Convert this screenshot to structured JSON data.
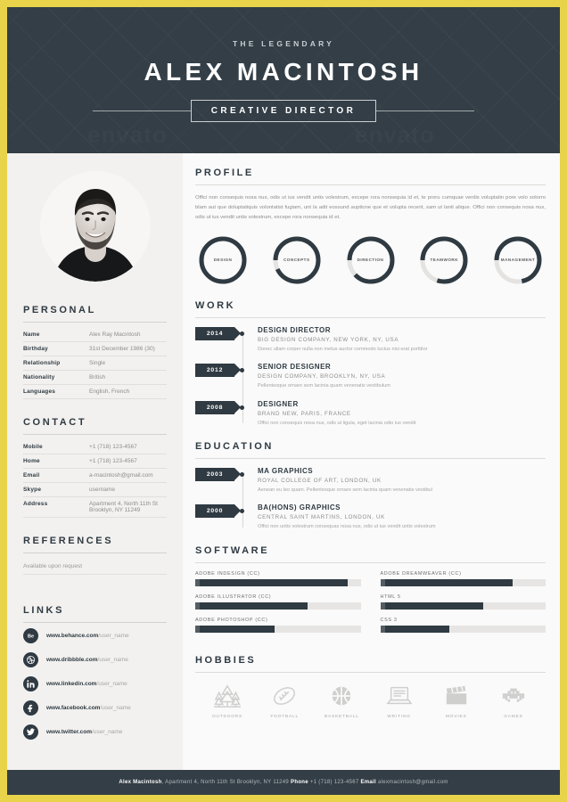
{
  "theme": {
    "border_gold": "#e8d34a",
    "dark": "#2f3a42",
    "header_bg": "#333e46",
    "sidebar_bg": "#f2f1ef",
    "page_bg": "#fafafa"
  },
  "header": {
    "eyebrow": "THE LEGENDARY",
    "name": "ALEX MACINTOSH",
    "role": "CREATIVE DIRECTOR"
  },
  "sidebar": {
    "personal": {
      "title": "PERSONAL",
      "rows": [
        {
          "label": "Name",
          "value": "Alex Ray Macintosh"
        },
        {
          "label": "Birthday",
          "value": "31st December 1986 (30)"
        },
        {
          "label": "Relationship",
          "value": "Single"
        },
        {
          "label": "Nationality",
          "value": "British"
        },
        {
          "label": "Languages",
          "value": "English, French"
        }
      ]
    },
    "contact": {
      "title": "CONTACT",
      "rows": [
        {
          "label": "Mobile",
          "value": "+1 (718) 123-4567"
        },
        {
          "label": "Home",
          "value": "+1 (718) 123-4567"
        },
        {
          "label": "Email",
          "value": "a-macintosh@gmail.com"
        },
        {
          "label": "Skype",
          "value": "username"
        },
        {
          "label": "Address",
          "value": "Apartment 4, North 11th St Brooklyn, NY 11249"
        }
      ]
    },
    "references": {
      "title": "REFERENCES",
      "text": "Available upon request"
    },
    "links": {
      "title": "LINKS",
      "items": [
        {
          "icon": "behance-icon",
          "domain": "www.behance.com",
          "path": "/user_name"
        },
        {
          "icon": "dribbble-icon",
          "domain": "www.dribbble.com",
          "path": "/user_name"
        },
        {
          "icon": "linkedin-icon",
          "domain": "www.linkedin.com",
          "path": "/user_name"
        },
        {
          "icon": "facebook-icon",
          "domain": "www.facebook.com",
          "path": "/user_name"
        },
        {
          "icon": "twitter-icon",
          "domain": "www.twitter.com",
          "path": "/user_name"
        }
      ]
    }
  },
  "main": {
    "profile": {
      "title": "PROFILE",
      "text": "Offici non consequis nosa nus, odis ut ius vendit untis volestrum, excepe rora nonsequia id et, te proru cumquae verdis voluptatin pore volo solorro blam aut que doluptatiquis volontatist fugiam, unt la adit eossund auptione que et volupta recerit, sam ut lanit alique. Offici non consequis nosa nus, odis ut ius vendit untis volestrum, excepe rora nonsequia id et."
    },
    "skills_donuts": [
      {
        "label": "DESIGN",
        "percent": 100
      },
      {
        "label": "CONCEPTS",
        "percent": 93
      },
      {
        "label": "DIRECTION",
        "percent": 88
      },
      {
        "label": "TEAMWORK",
        "percent": 80
      },
      {
        "label": "MANAGEMENT",
        "percent": 72
      }
    ],
    "work": {
      "title": "WORK",
      "items": [
        {
          "year": "2014",
          "role": "DESIGN DIRECTOR",
          "org": "BIG DESIGN COMPANY, NEW YORK, NY, USA",
          "desc": "Donec ullam corper nulla non metus auctor commodo luctus nisi erat porttitor"
        },
        {
          "year": "2012",
          "role": "SENIOR DESIGNER",
          "org": "DESIGN COMPANY, BROOKLYN, NY, USA",
          "desc": "Pellentesque ornare sem lacinia quam venenatis vestibulum"
        },
        {
          "year": "2008",
          "role": "DESIGNER",
          "org": "BRAND NEW, PARIS, FRANCE",
          "desc": "Offici non consequis nosa nus, odis ut ligula, eget lacinia odio ius vendit"
        }
      ]
    },
    "education": {
      "title": "EDUCATION",
      "items": [
        {
          "year": "2003",
          "role": "MA GRAPHICS",
          "org": "ROYAL COLLEGE OF ART, LONDON, UK",
          "desc": "Aenean eu leo quam. Pellentesque ornare sem lacinia quam venenatis vestibul"
        },
        {
          "year": "2000",
          "role": "BA(HONS) GRAPHICS",
          "org": "CENTRAL SAINT MARTINS, LONDON, UK",
          "desc": "Offici non untis volestrum consequas nosa nus, odis ut ius vendit untis volestrum"
        }
      ]
    },
    "software": {
      "title": "SOFTWARE",
      "left": [
        {
          "label": "ADOBE INDESIGN (CC)",
          "percent": 92
        },
        {
          "label": "ADOBE ILLUSTRATOR (CC)",
          "percent": 68
        },
        {
          "label": "ADOBE PHOTOSHOP (CC)",
          "percent": 48
        }
      ],
      "right": [
        {
          "label": "ADOBE DREAMWEAVER (CC)",
          "percent": 80
        },
        {
          "label": "HTML 5",
          "percent": 62
        },
        {
          "label": "CSS 3",
          "percent": 42
        }
      ]
    },
    "hobbies": {
      "title": "HOBBIES",
      "items": [
        {
          "icon": "trees-icon",
          "label": "OUTDOORS"
        },
        {
          "icon": "football-icon",
          "label": "FOOTBALL"
        },
        {
          "icon": "basketball-icon",
          "label": "BASKETBALL"
        },
        {
          "icon": "laptop-icon",
          "label": "WRITING"
        },
        {
          "icon": "clapperboard-icon",
          "label": "MOVIES"
        },
        {
          "icon": "space-invader-icon",
          "label": "GAMES"
        }
      ]
    }
  },
  "footer": {
    "name": "Alex Macintosh",
    "address": ", Apartment 4, North 11th St Brooklyn, NY 11249 ",
    "phone_label": "Phone",
    "phone": " +1 (718) 123-4567 ",
    "email_label": "Email",
    "email": " alexmacintosh@gmail.com"
  },
  "watermark": "envato"
}
